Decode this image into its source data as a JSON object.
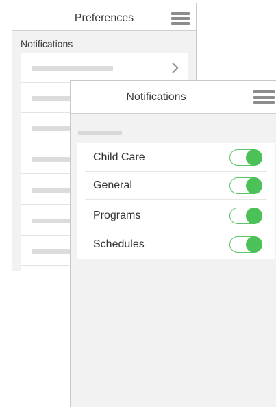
{
  "preferences_screen": {
    "title": "Preferences",
    "menu_icon": "hamburger-menu-icon",
    "section_label": "Notifications",
    "items": [
      {
        "placeholder": true,
        "has_chevron": true
      },
      {
        "placeholder": true
      },
      {
        "placeholder": true
      },
      {
        "placeholder": true
      },
      {
        "placeholder": true
      },
      {
        "placeholder": true
      },
      {
        "placeholder": true
      }
    ]
  },
  "notifications_screen": {
    "title": "Notifications",
    "menu_icon": "hamburger-menu-icon",
    "toggles": [
      {
        "label": "Child Care",
        "on": true
      },
      {
        "label": "General",
        "on": true
      },
      {
        "label": "Programs",
        "on": true
      },
      {
        "label": "Schedules",
        "on": true
      }
    ]
  },
  "colors": {
    "toggle_on": "#4cc158",
    "background": "#f2f2f2",
    "icon_gray": "#8c8c8c"
  }
}
